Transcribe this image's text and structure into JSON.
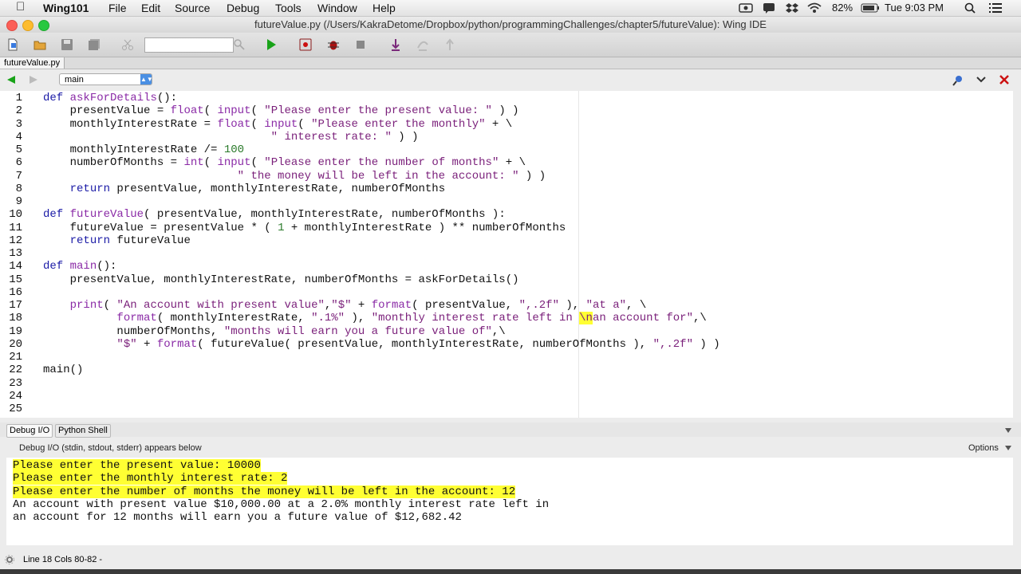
{
  "menubar": {
    "app_name": "Wing101",
    "items": [
      "File",
      "Edit",
      "Source",
      "Debug",
      "Tools",
      "Window",
      "Help"
    ],
    "battery": "82%",
    "clock": "Tue 9:03 PM"
  },
  "window": {
    "title": "futureValue.py (/Users/KakraDetome/Dropbox/python/programmingChallenges/chapter5/futureValue): Wing IDE"
  },
  "toolbar": {
    "search_value": ""
  },
  "editor": {
    "tab_label": "futureValue.py",
    "scope_select": "main",
    "lines": [
      {
        "n": "1",
        "html": "<span class='kw'>def</span> <span class='fn'>askForDetails</span>():"
      },
      {
        "n": "2",
        "html": "    presentValue = <span class='fn'>float</span>( <span class='fn'>input</span>( <span class='str'>\"Please enter the present value: \"</span> ) )"
      },
      {
        "n": "3",
        "html": "    monthlyInterestRate = <span class='fn'>float</span>( <span class='fn'>input</span>( <span class='str'>\"Please enter the monthly\"</span> + \\"
      },
      {
        "n": "4",
        "html": "                                  <span class='str'>\" interest rate: \"</span> ) )"
      },
      {
        "n": "5",
        "html": "    monthlyInterestRate /= <span class='num'>100</span>"
      },
      {
        "n": "6",
        "html": "    numberOfMonths = <span class='fn'>int</span>( <span class='fn'>input</span>( <span class='str'>\"Please enter the number of months\"</span> + \\"
      },
      {
        "n": "7",
        "html": "                             <span class='str'>\" the money will be left in the account: \"</span> ) )"
      },
      {
        "n": "8",
        "html": "    <span class='kw'>return</span> presentValue, monthlyInterestRate, numberOfMonths"
      },
      {
        "n": "9",
        "html": ""
      },
      {
        "n": "10",
        "html": "<span class='kw'>def</span> <span class='fn'>futureValue</span>( presentValue, monthlyInterestRate, numberOfMonths ):"
      },
      {
        "n": "11",
        "html": "    futureValue = presentValue * ( <span class='num'>1</span> + monthlyInterestRate ) ** numberOfMonths"
      },
      {
        "n": "12",
        "html": "    <span class='kw'>return</span> futureValue"
      },
      {
        "n": "13",
        "html": ""
      },
      {
        "n": "14",
        "html": "<span class='kw'>def</span> <span class='fn'>main</span>():"
      },
      {
        "n": "15",
        "html": "    presentValue, monthlyInterestRate, numberOfMonths = askForDetails()"
      },
      {
        "n": "16",
        "html": ""
      },
      {
        "n": "17",
        "html": "    <span class='fn'>print</span>( <span class='str'>\"An account with present value\"</span>,<span class='str'>\"$\"</span> + <span class='fn'>format</span>( presentValue, <span class='str'>\",.2f\"</span> ), <span class='str'>\"at a\"</span>, \\"
      },
      {
        "n": "18",
        "html": "           <span class='fn'>format</span>( monthlyInterestRate, <span class='str'>\".1%\"</span> ), <span class='str'>\"monthly interest rate left in <span class='hl'>\\n</span>an account for\"</span>,\\"
      },
      {
        "n": "19",
        "html": "           numberOfMonths, <span class='str'>\"months will earn you a future value of\"</span>,\\"
      },
      {
        "n": "20",
        "html": "           <span class='str'>\"$\"</span> + <span class='fn'>format</span>( futureValue( presentValue, monthlyInterestRate, numberOfMonths ), <span class='str'>\",.2f\"</span> ) )"
      },
      {
        "n": "21",
        "html": ""
      },
      {
        "n": "22",
        "html": "main()"
      },
      {
        "n": "23",
        "html": ""
      },
      {
        "n": "24",
        "html": ""
      },
      {
        "n": "25",
        "html": ""
      }
    ]
  },
  "debug_panel": {
    "tabs": [
      "Debug I/O",
      "Python Shell"
    ],
    "subtitle": "Debug I/O (stdin, stdout, stderr) appears below",
    "options_label": "Options",
    "output": [
      {
        "text": "Please enter the present value: 10000",
        "highlight": true
      },
      {
        "text": "Please enter the monthly interest rate: 2",
        "highlight": true
      },
      {
        "text": "Please enter the number of months the money will be left in the account: 12",
        "highlight": true
      },
      {
        "text": "An account with present value $10,000.00 at a 2.0% monthly interest rate left in",
        "highlight": false
      },
      {
        "text": "an account for 12 months will earn you a future value of $12,682.42",
        "highlight": false
      }
    ]
  },
  "statusbar": {
    "text": "Line 18 Cols 80-82 -"
  },
  "colors": {
    "highlight": "#ffff33",
    "keyword": "#1a1aa6",
    "string": "#7a1f7a",
    "run_green": "#19a319",
    "close_red": "#cc1111"
  }
}
